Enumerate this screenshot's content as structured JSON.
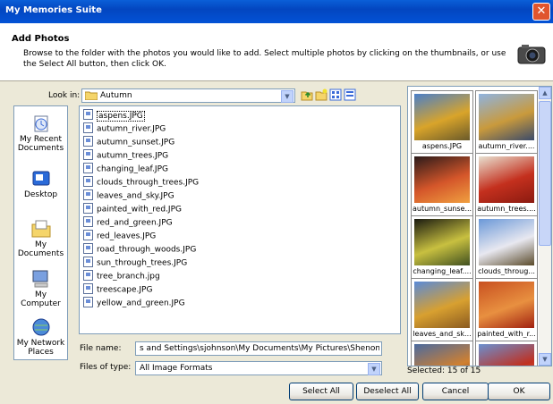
{
  "window": {
    "title": "My Memories Suite",
    "close_glyph": "✕"
  },
  "header": {
    "title": "Add Photos",
    "description": "Browse to the folder with the photos you would like to add. Select multiple photos by clicking on the thumbnails, or use the Select All button, then click OK.",
    "icon": "camera-icon"
  },
  "lookin": {
    "label": "Look in:",
    "value": "Autumn"
  },
  "places": [
    {
      "label": "My Recent Documents",
      "icon": "recent-documents-icon"
    },
    {
      "label": "Desktop",
      "icon": "desktop-icon"
    },
    {
      "label": "My Documents",
      "icon": "my-documents-icon"
    },
    {
      "label": "My Computer",
      "icon": "my-computer-icon"
    },
    {
      "label": "My Network Places",
      "icon": "network-places-icon"
    }
  ],
  "files": [
    "aspens.JPG",
    "autumn_river.JPG",
    "autumn_sunset.JPG",
    "autumn_trees.JPG",
    "changing_leaf.JPG",
    "clouds_through_trees.JPG",
    "leaves_and_sky.JPG",
    "painted_with_red.JPG",
    "red_and_green.JPG",
    "red_leaves.JPG",
    "road_through_woods.JPG",
    "sun_through_trees.JPG",
    "tree_branch.jpg",
    "treescape.JPG",
    "yellow_and_green.JPG"
  ],
  "filename": {
    "label": "File name:",
    "value": "s and Settings\\sjohnson\\My Documents\\My Pictures\\Shenom\\Autumn"
  },
  "filetype": {
    "label": "Files of type:",
    "value": "All Image Formats"
  },
  "thumbnails": [
    {
      "caption": "aspens.JPG",
      "colors": [
        "#4a7fc9",
        "#d9a42a",
        "#6a5a2a"
      ]
    },
    {
      "caption": "autumn_river....",
      "colors": [
        "#8fb3e0",
        "#c99a3c",
        "#3a4a6a"
      ]
    },
    {
      "caption": "autumn_sunse...",
      "colors": [
        "#2a1a1a",
        "#d4562a",
        "#f0a040"
      ]
    },
    {
      "caption": "autumn_trees....",
      "colors": [
        "#e8e0d0",
        "#c4301e",
        "#8a1a10"
      ]
    },
    {
      "caption": "changing_leaf....",
      "colors": [
        "#1a1a10",
        "#c8c040",
        "#405020"
      ]
    },
    {
      "caption": "clouds_throug...",
      "colors": [
        "#6a98d8",
        "#e8e8f0",
        "#5a4a2a"
      ]
    },
    {
      "caption": "leaves_and_sk...",
      "colors": [
        "#5a8ad8",
        "#d8a030",
        "#8a5a20"
      ]
    },
    {
      "caption": "painted_with_r...",
      "colors": [
        "#c85020",
        "#e89040",
        "#a02010"
      ]
    },
    {
      "caption": "",
      "colors": [
        "#4a6aa0",
        "#d08030",
        "#703010"
      ]
    },
    {
      "caption": "",
      "colors": [
        "#6a90d0",
        "#c03020",
        "#e07040"
      ]
    }
  ],
  "selected": "Selected: 15 of 15",
  "buttons": {
    "select_all": "Select All",
    "deselect_all": "Deselect All",
    "cancel": "Cancel",
    "ok": "OK"
  }
}
